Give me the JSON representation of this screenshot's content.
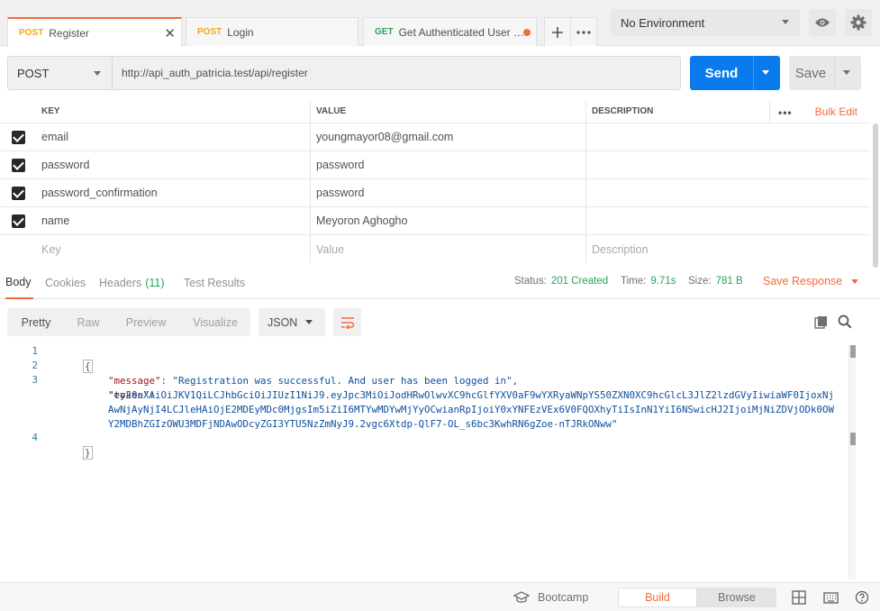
{
  "tabs": [
    {
      "method": "POST",
      "name": "Register"
    },
    {
      "method": "POST",
      "name": "Login"
    },
    {
      "method": "GET",
      "name": "Get Authenticated User D..."
    }
  ],
  "environment": {
    "selected": "No Environment"
  },
  "request": {
    "method": "POST",
    "url": "http://api_auth_patricia.test/api/register",
    "send_label": "Send",
    "save_label": "Save"
  },
  "params": {
    "headers": {
      "key": "KEY",
      "value": "VALUE",
      "description": "DESCRIPTION",
      "bulk_edit": "Bulk Edit"
    },
    "rows": [
      {
        "key": "email",
        "value": "youngmayor08@gmail.com",
        "description": ""
      },
      {
        "key": "password",
        "value": "password",
        "description": ""
      },
      {
        "key": "password_confirmation",
        "value": "password",
        "description": ""
      },
      {
        "key": "name",
        "value": "Meyoron Aghogho",
        "description": ""
      }
    ],
    "placeholders": {
      "key": "Key",
      "value": "Value",
      "description": "Description"
    }
  },
  "response": {
    "tabs": {
      "body": "Body",
      "cookies": "Cookies",
      "headers": "Headers",
      "headers_count": "(11)",
      "test_results": "Test Results"
    },
    "status_label": "Status:",
    "status_value": "201 Created",
    "time_label": "Time:",
    "time_value": "9.71s",
    "size_label": "Size:",
    "size_value": "781 B",
    "save_response": "Save Response",
    "views": [
      "Pretty",
      "Raw",
      "Preview",
      "Visualize"
    ],
    "format": "JSON",
    "code": {
      "line_numbers": [
        "1",
        "2",
        "3",
        "4"
      ],
      "open_brace": "{",
      "close_brace": "}",
      "message_key": "\"message\"",
      "message_value": "\"Registration was successful. And user has been logged in\"",
      "token_key": "\"token\"",
      "token_line1": "\"eyJ0eXAiOiJKV1QiLCJhbGciOiJIUzI1NiJ9.eyJpc3MiOiJodHRwOlwvXC9hcGlfYXV0aF9wYXRyaWNpYS50ZXN0XC9hcGlcL3JlZ2lzdGVyIiwiaWF0IjoxNj",
      "token_line2": "AwNjAyNjI4LCJleHAiOjE2MDEyMDc0MjgsIm5iZiI6MTYwMDYwMjYyOCwianRpIjoiY0xYNFEzVEx6V0FQOXhyTiIsInN1YiI6NSwicHJ2IjoiMjNiZDVjODk0OW",
      "token_line3": "Y2MDBhZGIzOWU3MDFjNDAwODcyZGI3YTU5NzZmNyJ9.2vgc6Xtdp-QlF7-OL_s6bc3KwhRN6gZoe-nTJRkONww\""
    }
  },
  "statusbar": {
    "bootcamp": "Bootcamp",
    "build": "Build",
    "browse": "Browse"
  }
}
